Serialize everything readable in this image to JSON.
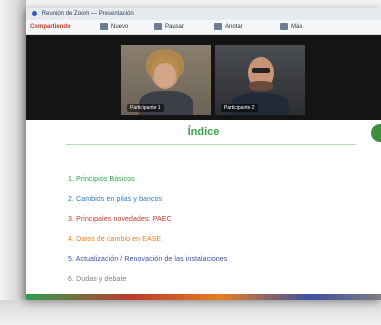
{
  "app_bar": {
    "title": "Reunión de Zoom — Presentación"
  },
  "toolbar": {
    "label": "Compartiendo",
    "buttons": [
      {
        "label": "Nuevo",
        "icon": "new-share-icon"
      },
      {
        "label": "Pausar",
        "icon": "pause-icon"
      },
      {
        "label": "Anotar",
        "icon": "annotate-icon"
      },
      {
        "label": "Más",
        "icon": "more-icon"
      }
    ]
  },
  "participants": [
    {
      "name": "Participante 1"
    },
    {
      "name": "Participante 2"
    }
  ],
  "slide": {
    "title": "Índice",
    "items": [
      {
        "text": "1. Principios Básicos",
        "color": "#2f9e4f"
      },
      {
        "text": "2. Cambios en pilas y bancos",
        "color": "#2a7bbf"
      },
      {
        "text": "3. Principales novedades: PAEC",
        "color": "#c0392b"
      },
      {
        "text": "4. Datos de cambio en EASE",
        "color": "#e67e22"
      },
      {
        "text": "5. Actualización / Renovación de las instalaciones",
        "color": "#3d4fa3"
      },
      {
        "text": "6. Dudas y debate",
        "color": "#7f7f7f"
      }
    ]
  },
  "colors": {
    "title_green": "#3aa14a",
    "badge_green": "#3b8f3f"
  }
}
